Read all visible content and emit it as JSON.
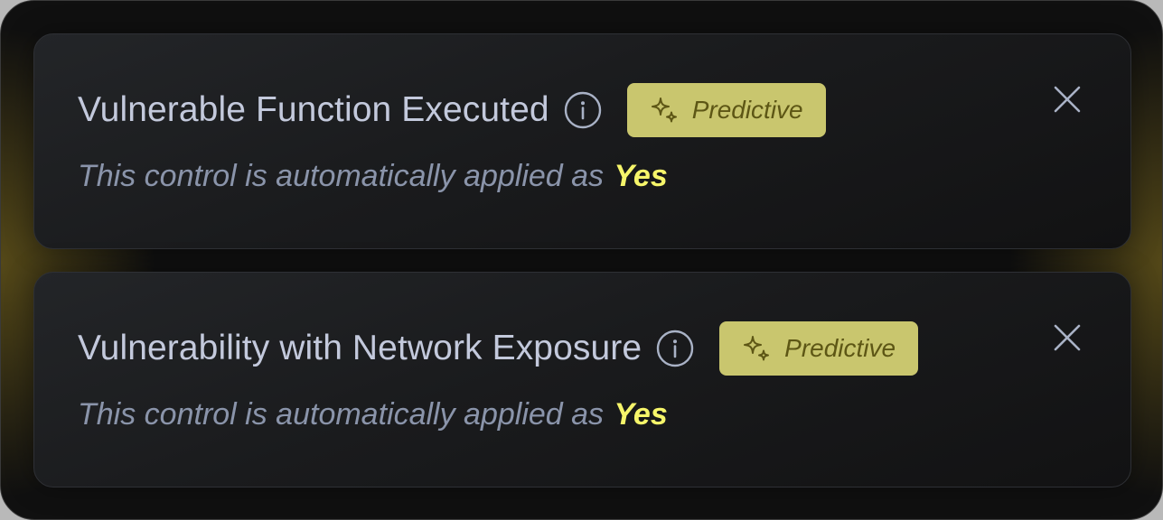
{
  "colors": {
    "title": "#c3c9dc",
    "description": "#8a94aa",
    "accent_yes": "#f6f56a",
    "badge_background": "#c9c66e",
    "badge_text": "#5d5615",
    "card_border": "#2e3035",
    "glow": "#8c761e"
  },
  "cards": [
    {
      "title": "Vulnerable Function Executed",
      "info_icon": "info-circle-icon",
      "badge": {
        "icon": "sparkles-icon",
        "label": "Predictive"
      },
      "close_icon": "close-icon",
      "description": "This control is automatically applied as",
      "value": "Yes"
    },
    {
      "title": "Vulnerability with Network Exposure",
      "info_icon": "info-circle-icon",
      "badge": {
        "icon": "sparkles-icon",
        "label": "Predictive"
      },
      "close_icon": "close-icon",
      "description": "This control is automatically applied as",
      "value": "Yes"
    }
  ]
}
